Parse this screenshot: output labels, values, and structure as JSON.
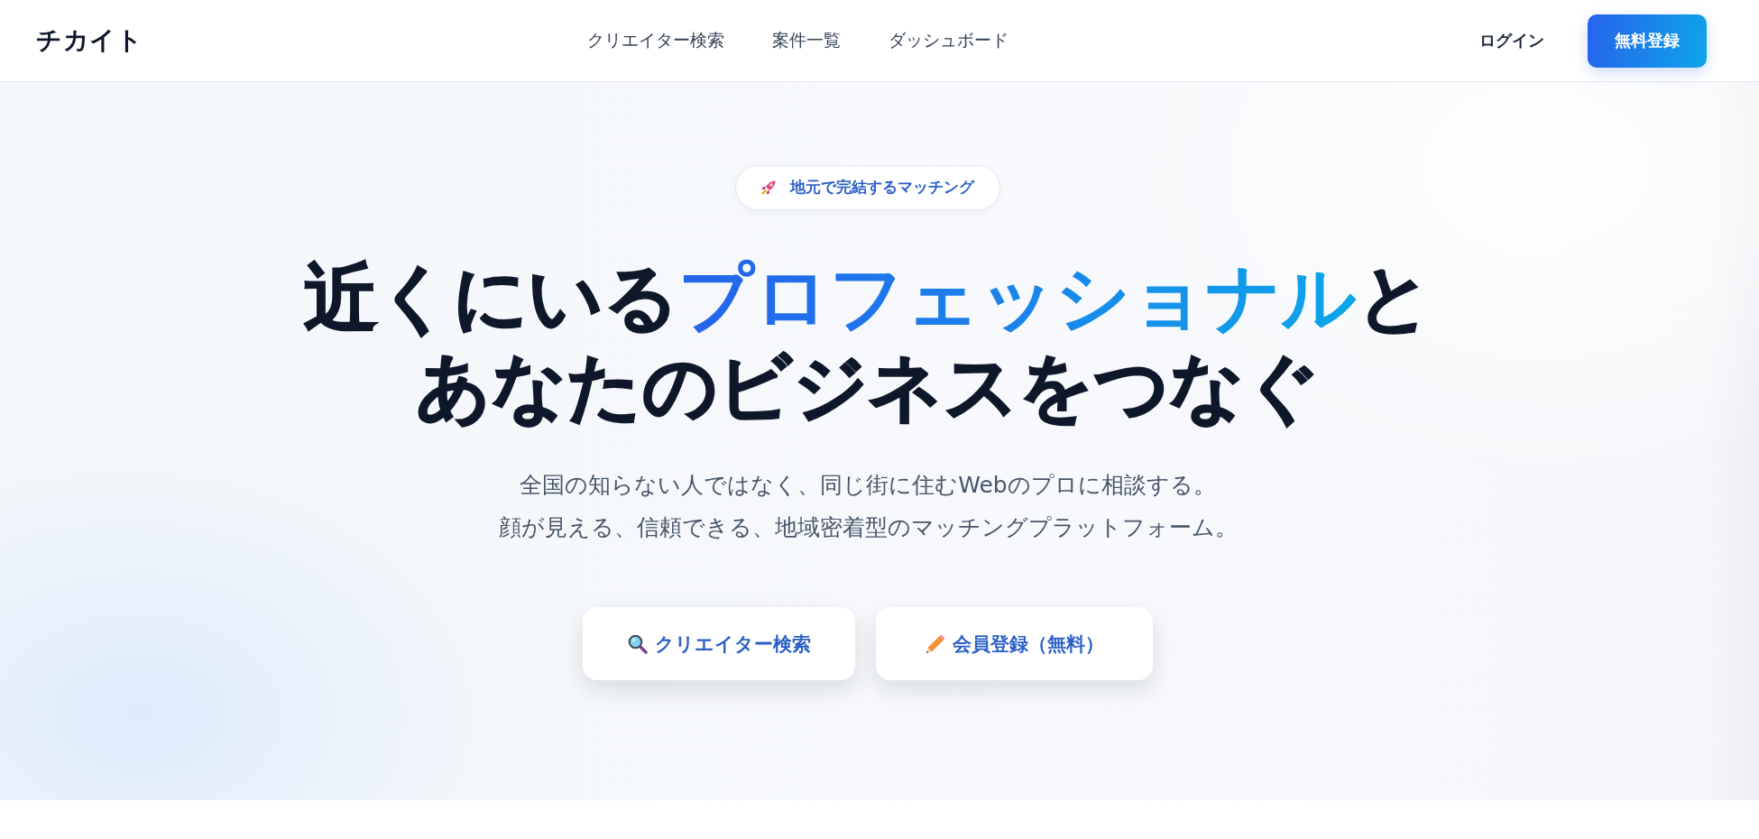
{
  "header": {
    "logo": "チカイト",
    "nav": [
      {
        "label": "クリエイター検索"
      },
      {
        "label": "案件一覧"
      },
      {
        "label": "ダッシュボード"
      }
    ],
    "login": "ログイン",
    "register_button": "無料登録"
  },
  "hero": {
    "badge": {
      "text": "地元で完結するマッチング"
    },
    "headline": {
      "lines": [
        [
          {
            "text": "近くにいる",
            "highlight": false
          },
          {
            "text": "プロフェッショナル",
            "highlight": true
          },
          {
            "text": "と",
            "highlight": false
          }
        ],
        [
          {
            "text": "あなたのビジネスをつなぐ",
            "highlight": false
          }
        ]
      ]
    },
    "subtitle": {
      "lines": [
        "全国の知らない人ではなく、同じ街に住むWebのプロに相談する。",
        "顔が見える、信頼できる、地域密着型のマッチングプラットフォーム。"
      ]
    },
    "buttons": [
      {
        "label": "クリエイター検索",
        "kind": "search"
      },
      {
        "label": "会員登録（無料）",
        "kind": "register"
      }
    ]
  }
}
